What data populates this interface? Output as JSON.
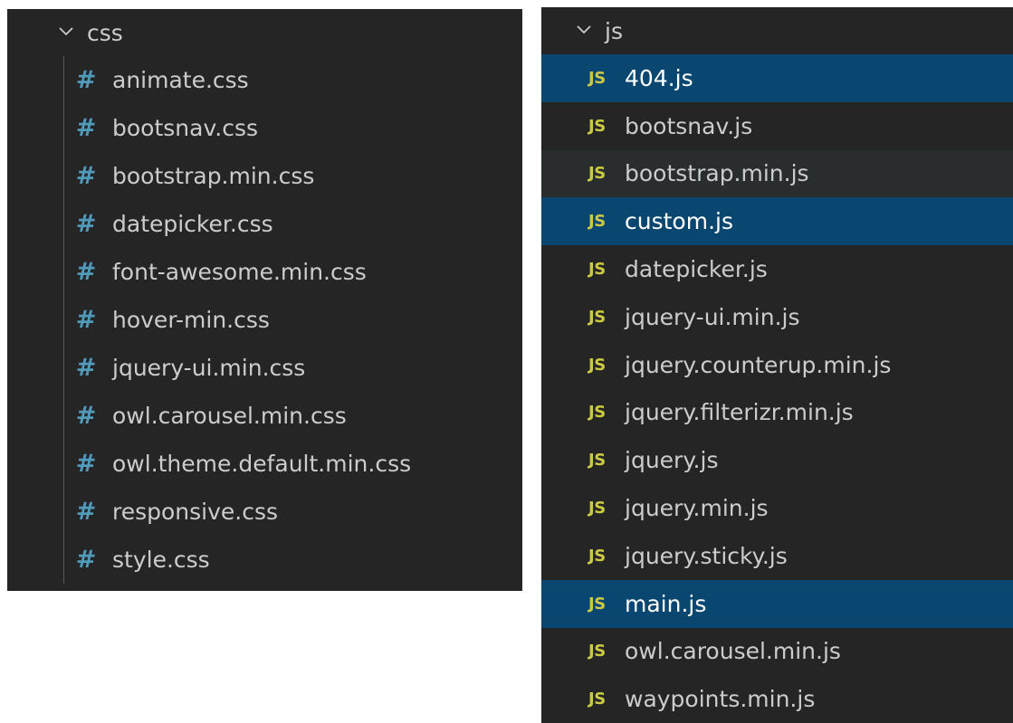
{
  "css_panel": {
    "folder": {
      "name": "css",
      "chevron_icon": "chevron-down-icon"
    },
    "file_icon": {
      "glyph": "#",
      "color": "#519aba",
      "name": "hash-icon"
    },
    "files": [
      {
        "label": "animate.css"
      },
      {
        "label": "bootsnav.css"
      },
      {
        "label": "bootstrap.min.css"
      },
      {
        "label": "datepicker.css"
      },
      {
        "label": "font-awesome.min.css"
      },
      {
        "label": "hover-min.css"
      },
      {
        "label": "jquery-ui.min.css"
      },
      {
        "label": "owl.carousel.min.css"
      },
      {
        "label": "owl.theme.default.min.css"
      },
      {
        "label": "responsive.css"
      },
      {
        "label": "style.css"
      }
    ]
  },
  "js_panel": {
    "folder": {
      "name": "js",
      "chevron_icon": "chevron-down-icon"
    },
    "file_icon": {
      "glyph": "JS",
      "color": "#cbcb41",
      "name": "js-file-icon"
    },
    "files": [
      {
        "label": "404.js",
        "state": "selected"
      },
      {
        "label": "bootsnav.js",
        "state": ""
      },
      {
        "label": "bootstrap.min.js",
        "state": "hovered"
      },
      {
        "label": "custom.js",
        "state": "selected"
      },
      {
        "label": "datepicker.js",
        "state": ""
      },
      {
        "label": "jquery-ui.min.js",
        "state": ""
      },
      {
        "label": "jquery.counterup.min.js",
        "state": ""
      },
      {
        "label": "jquery.filterizr.min.js",
        "state": ""
      },
      {
        "label": "jquery.js",
        "state": ""
      },
      {
        "label": "jquery.min.js",
        "state": ""
      },
      {
        "label": "jquery.sticky.js",
        "state": ""
      },
      {
        "label": "main.js",
        "state": "selected"
      },
      {
        "label": "owl.carousel.min.js",
        "state": ""
      },
      {
        "label": "waypoints.min.js",
        "state": ""
      }
    ]
  },
  "colors": {
    "panel_bg": "#252526",
    "text": "#cccccc",
    "selected_bg": "#094771",
    "hover_bg": "#2a2d2e",
    "css_icon": "#519aba",
    "js_icon": "#cbcb41"
  }
}
